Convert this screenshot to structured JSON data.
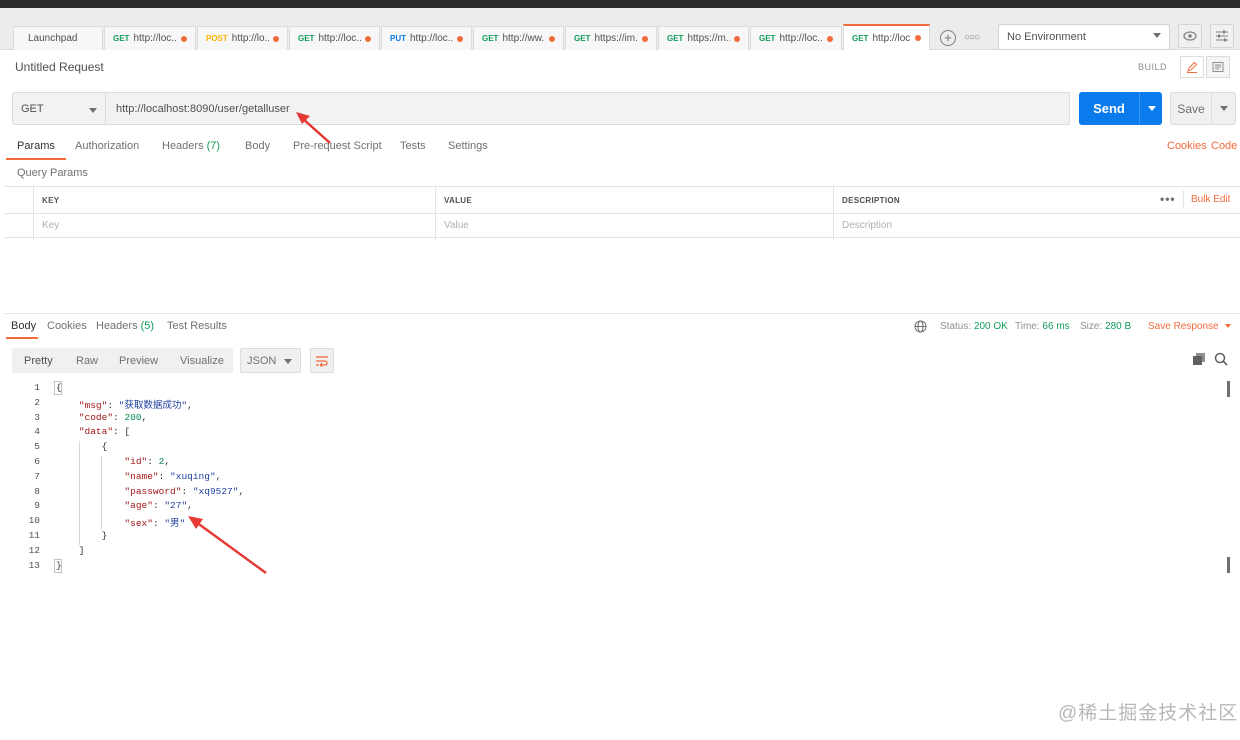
{
  "tabs": [
    {
      "method": "",
      "label": "Launchpad",
      "dot": false,
      "active": false
    },
    {
      "method": "GET",
      "label": "http://loc...",
      "dot": true,
      "active": false
    },
    {
      "method": "POST",
      "label": "http://lo...",
      "dot": true,
      "active": false
    },
    {
      "method": "GET",
      "label": "http://loc...",
      "dot": true,
      "active": false
    },
    {
      "method": "PUT",
      "label": "http://loc...",
      "dot": true,
      "active": false
    },
    {
      "method": "GET",
      "label": "http://ww...",
      "dot": true,
      "active": false
    },
    {
      "method": "GET",
      "label": "https://im...",
      "dot": true,
      "active": false
    },
    {
      "method": "GET",
      "label": "https://m...",
      "dot": true,
      "active": false
    },
    {
      "method": "GET",
      "label": "http://loc...",
      "dot": true,
      "active": false
    },
    {
      "method": "GET",
      "label": "http://loc...",
      "dot": true,
      "active": true
    }
  ],
  "environment": {
    "selected": "No Environment"
  },
  "request": {
    "title": "Untitled Request",
    "build_label": "BUILD",
    "method": "GET",
    "url": "http://localhost:8090/user/getalluser",
    "send_label": "Send",
    "save_label": "Save"
  },
  "request_tabs": {
    "params": "Params",
    "authorization": "Authorization",
    "headers": "Headers",
    "headers_count": "(7)",
    "body": "Body",
    "prerequest": "Pre-request Script",
    "tests": "Tests",
    "settings": "Settings",
    "cookies": "Cookies",
    "code": "Code"
  },
  "query_params": {
    "label": "Query Params",
    "columns": [
      "KEY",
      "VALUE",
      "DESCRIPTION"
    ],
    "placeholders": [
      "Key",
      "Value",
      "Description"
    ],
    "bulk_edit": "Bulk Edit",
    "more": "•••"
  },
  "response_tabs": {
    "body": "Body",
    "cookies": "Cookies",
    "headers": "Headers",
    "headers_count": "(5)",
    "test_results": "Test Results"
  },
  "response_status": {
    "status_label": "Status:",
    "status_value": "200 OK",
    "time_label": "Time:",
    "time_value": "66 ms",
    "size_label": "Size:",
    "size_value": "280 B",
    "save_response": "Save Response"
  },
  "response_view": {
    "modes": [
      "Pretty",
      "Raw",
      "Preview",
      "Visualize"
    ],
    "format": "JSON"
  },
  "response_body": [
    {
      "n": "1",
      "parts": [
        [
          "p",
          "{"
        ]
      ]
    },
    {
      "n": "2",
      "parts": [
        [
          "p",
          "    "
        ],
        [
          "k",
          "\"msg\""
        ],
        [
          "p",
          ": "
        ],
        [
          "s",
          "\"获取数据成功\""
        ],
        [
          "p",
          ","
        ]
      ]
    },
    {
      "n": "3",
      "parts": [
        [
          "p",
          "    "
        ],
        [
          "k",
          "\"code\""
        ],
        [
          "p",
          ": "
        ],
        [
          "n",
          "200"
        ],
        [
          "p",
          ","
        ]
      ]
    },
    {
      "n": "4",
      "parts": [
        [
          "p",
          "    "
        ],
        [
          "k",
          "\"data\""
        ],
        [
          "p",
          ": ["
        ]
      ]
    },
    {
      "n": "5",
      "parts": [
        [
          "p",
          "        {"
        ]
      ]
    },
    {
      "n": "6",
      "parts": [
        [
          "p",
          "            "
        ],
        [
          "k",
          "\"id\""
        ],
        [
          "p",
          ": "
        ],
        [
          "n",
          "2"
        ],
        [
          "p",
          ","
        ]
      ]
    },
    {
      "n": "7",
      "parts": [
        [
          "p",
          "            "
        ],
        [
          "k",
          "\"name\""
        ],
        [
          "p",
          ": "
        ],
        [
          "s",
          "\"xuqing\""
        ],
        [
          "p",
          ","
        ]
      ]
    },
    {
      "n": "8",
      "parts": [
        [
          "p",
          "            "
        ],
        [
          "k",
          "\"password\""
        ],
        [
          "p",
          ": "
        ],
        [
          "s",
          "\"xq9527\""
        ],
        [
          "p",
          ","
        ]
      ]
    },
    {
      "n": "9",
      "parts": [
        [
          "p",
          "            "
        ],
        [
          "k",
          "\"age\""
        ],
        [
          "p",
          ": "
        ],
        [
          "s",
          "\"27\""
        ],
        [
          "p",
          ","
        ]
      ]
    },
    {
      "n": "10",
      "parts": [
        [
          "p",
          "            "
        ],
        [
          "k",
          "\"sex\""
        ],
        [
          "p",
          ": "
        ],
        [
          "s",
          "\"男\""
        ]
      ]
    },
    {
      "n": "11",
      "parts": [
        [
          "p",
          "        }"
        ]
      ]
    },
    {
      "n": "12",
      "parts": [
        [
          "p",
          "    ]"
        ]
      ]
    },
    {
      "n": "13",
      "parts": [
        [
          "p",
          "}"
        ]
      ]
    }
  ],
  "watermark": "@稀土掘金技术社区",
  "colors": {
    "accent": "#f26b3a",
    "send": "#097bed",
    "status_ok": "#0f9d58"
  }
}
